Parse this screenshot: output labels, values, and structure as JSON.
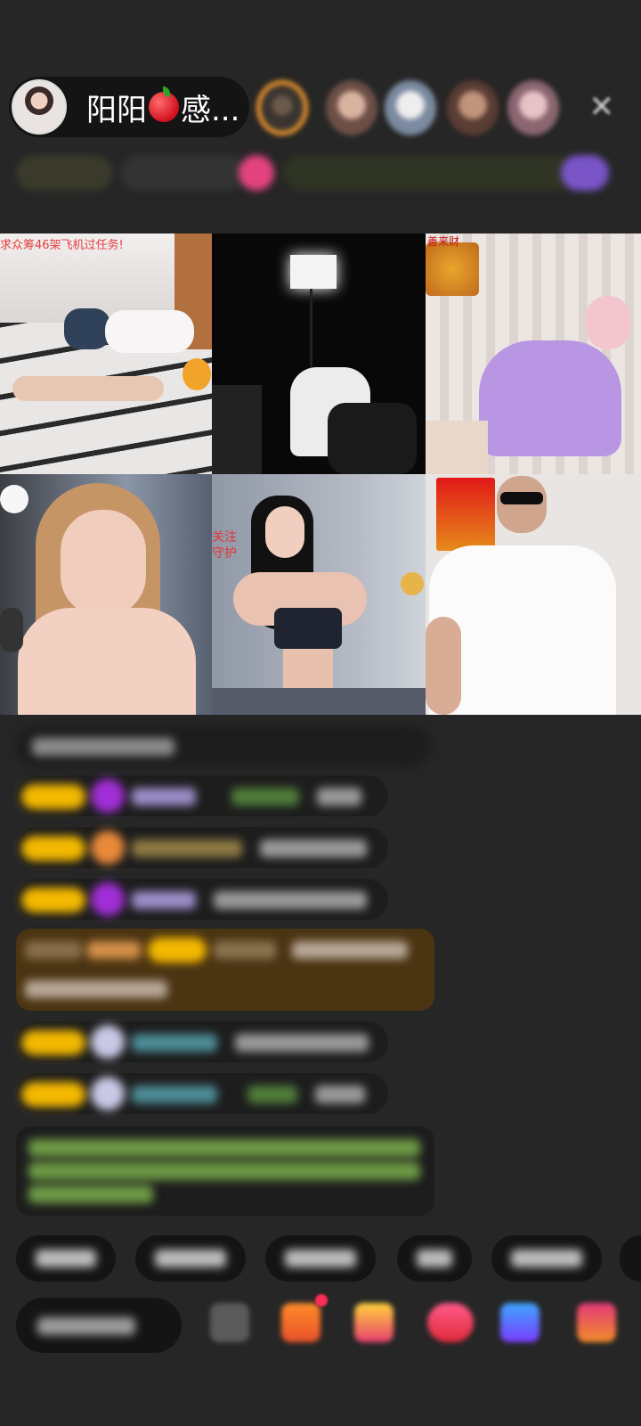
{
  "header": {
    "host_name": "阳阳",
    "host_name_suffix": "感...",
    "host_emoji_icon": "apple-icon",
    "close_icon": "close-icon",
    "viewer_count": 5
  },
  "grid": {
    "cells": [
      {
        "overlay_text": "求众筹46架飞机过任务!"
      },
      {
        "overlay_text": ""
      },
      {
        "overlay_text": "善来财"
      },
      {
        "overlay_text": ""
      },
      {
        "overlay_text": "关注\n守护"
      },
      {
        "overlay_text": ""
      }
    ]
  },
  "chat": {
    "message_count": 8
  },
  "quick_replies": {
    "count": 6
  },
  "bottom_bar": {
    "icons": [
      "grid-icon",
      "gift-box-icon",
      "treasure-icon",
      "rose-icon",
      "game-icon",
      "more-icon"
    ]
  },
  "colors": {
    "background": "#262626",
    "level_badge": "#f3b800",
    "accent_orange": "#f39a2d",
    "danmaku_green": "#9fd36b",
    "gift_pill": "#4b3412"
  }
}
